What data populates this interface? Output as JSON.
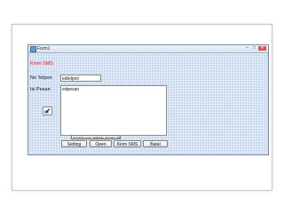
{
  "window": {
    "title": "Form1",
    "controls": {
      "minimize": "–",
      "maximize": "□",
      "close": "✕"
    }
  },
  "form": {
    "heading": "Kirim SMS",
    "phone_label": "No Telpon",
    "phone_value": "edtelpon",
    "message_label": "Isi Pesan",
    "message_value": "edpesan",
    "icon_button": "edit-icon",
    "tooltip": "pengirim.com gateway dengan delphi"
  },
  "buttons": {
    "setting": "Setting",
    "open": "Open",
    "kirim": "Kirim SMS",
    "batal": "Batal"
  },
  "colors": {
    "window_bg": "#c9d9ee",
    "heading": "#d11e1e",
    "close": "#d9534f"
  }
}
